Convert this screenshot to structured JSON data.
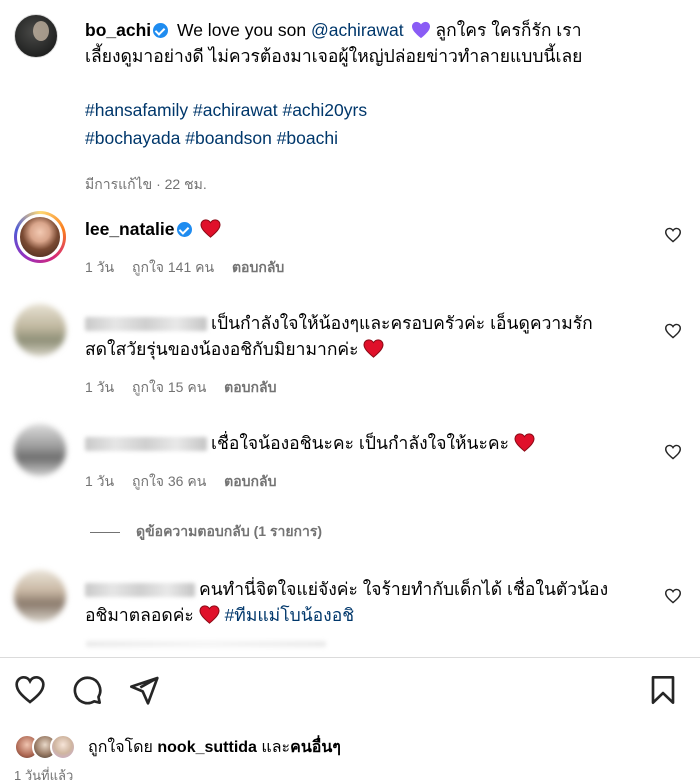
{
  "caption": {
    "username": "bo_achi",
    "text_start": "We love you son",
    "mention": "@achirawat",
    "text_end_line1": "ลูกใคร ใครก็รัก เรา",
    "text_line2": "เลี้ยงดูมาอย่างดี ไม่ควรต้องมาเจอผู้ใหญ่ปล่อยข่าวทำลายแบบนี้เลย",
    "hashtags_line1": "#hansafamily #achirawat #achi20yrs",
    "hashtags_line2": "#bochayada #boandson #boachi",
    "edited": "มีการแก้ไข · 22 ชม."
  },
  "comments": [
    {
      "username": "lee_natalie",
      "text": "",
      "time": "1 วัน",
      "likes": "ถูกใจ 141 คน",
      "reply": "ตอบกลับ"
    },
    {
      "username_blurred": true,
      "text_line1": "เป็นกำลังใจให้น้องๆและครอบครัวค่ะ เอ็นดูความรัก",
      "text_line2": "สดใสวัยรุ่นของน้องอชิกับมิยามากค่ะ",
      "time": "1 วัน",
      "likes": "ถูกใจ 15 คน",
      "reply": "ตอบกลับ"
    },
    {
      "username_blurred": true,
      "text_line1": "เชื่อใจน้องอชินะคะ เป็นกำลังใจให้นะคะ",
      "time": "1 วัน",
      "likes": "ถูกใจ 36 คน",
      "reply": "ตอบกลับ"
    },
    {
      "username_blurred": true,
      "text_line1": "คนทำนี่จิตใจแย่จังค่ะ ใจร้ายทำกับเด็กได้ เชื่อในตัวน้อง",
      "text_line2": "อชิมาตลอดค่ะ",
      "hashtag": "#ทีมแม่โบน้องอชิ"
    }
  ],
  "view_replies": "ดูข้อความตอบกลับ (1 รายการ)",
  "liked_by": {
    "prefix": "ถูกใจโดย",
    "user": "nook_suttida",
    "and": "และ",
    "others": "คนอื่นๆ"
  },
  "time_ago": "1 วันที่แล้ว",
  "colors": {
    "link": "#00376b",
    "meta": "#737373",
    "verified": "#1f8cf0",
    "heart_red": "#e0102a",
    "heart_purple": "#8a5cf5"
  },
  "icons": [
    "verified-badge-icon",
    "purple-heart-emoji",
    "red-heart-emoji",
    "like-heart-icon",
    "comment-icon",
    "share-icon",
    "bookmark-icon"
  ]
}
